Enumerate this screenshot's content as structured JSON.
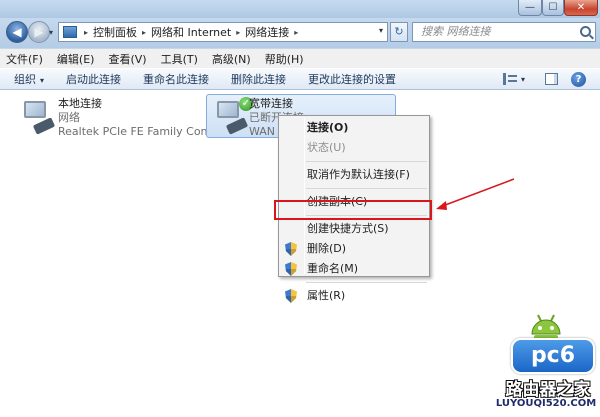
{
  "window": {
    "min_glyph": "—",
    "max_glyph": "☐",
    "close_glyph": "✕"
  },
  "nav": {
    "back_glyph": "◀",
    "forward_glyph": "▶",
    "dropdown_glyph": "▾",
    "breadcrumb": [
      "控制面板",
      "网络和 Internet",
      "网络连接"
    ],
    "separator": "▸",
    "refresh_glyph": "↻",
    "search_placeholder": "搜索 网络连接"
  },
  "menubar": {
    "items": [
      "文件(F)",
      "编辑(E)",
      "查看(V)",
      "工具(T)",
      "高级(N)",
      "帮助(H)"
    ]
  },
  "cmdbar": {
    "organize": "组织",
    "caret": "▾",
    "commands": [
      "启动此连接",
      "重命名此连接",
      "删除此连接",
      "更改此连接的设置"
    ],
    "help_glyph": "?"
  },
  "connections": {
    "local": {
      "name": "本地连接",
      "type": "网络",
      "device": "Realtek PCIe FE Family Control..."
    },
    "broadband": {
      "name": "宽带连接",
      "status": "已断开连接",
      "device": "WAN M",
      "check_glyph": "✓"
    }
  },
  "context_menu": {
    "connect": "连接(O)",
    "status": "状态(U)",
    "cancel_default": "取消作为默认连接(F)",
    "create_copy": "创建副本(C)",
    "create_shortcut": "创建快捷方式(S)",
    "delete": "删除(D)",
    "rename": "重命名(M)",
    "properties": "属性(R)"
  },
  "watermark": {
    "logo": "pc6",
    "site_name": "路由器之家",
    "url": "LUYOUQI520.COM"
  },
  "colors": {
    "highlight_box": "#d9161c",
    "selection_bg": "#cde0f5"
  }
}
